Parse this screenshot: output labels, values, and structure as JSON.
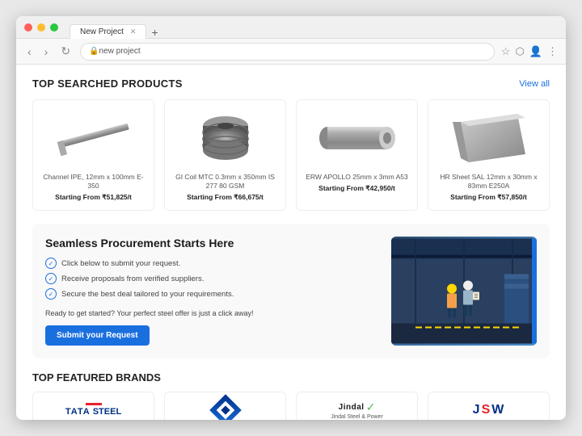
{
  "browser": {
    "tab_title": "New Project",
    "address": "new project",
    "new_tab_symbol": "+",
    "nav_back": "‹",
    "nav_forward": "›"
  },
  "sections": {
    "top_products": {
      "title": "TOP SEARCHED PRODUCTS",
      "view_all": "View all",
      "products": [
        {
          "name": "Channel IPE, 12mm x 100mm E-350",
          "price": "Starting From ₹51,825/t",
          "type": "channel"
        },
        {
          "name": "GI Coil MTC 0.3mm x 350mm IS 277 80 GSM",
          "price": "Starting From ₹66,675/t",
          "type": "coil"
        },
        {
          "name": "ERW APOLLO 25mm x 3mm A53",
          "price": "Starting From ₹42,950/t",
          "type": "pipe"
        },
        {
          "name": "HR Sheet SAL 12mm x 30mm x 83mm E250A",
          "price": "Starting From ₹57,850/t",
          "type": "sheet"
        }
      ]
    },
    "procurement": {
      "title": "Seamless Procurement Starts Here",
      "checklist": [
        "Click below to submit your request.",
        "Receive proposals from verified suppliers.",
        "Secure the best deal tailored to your requirements."
      ],
      "cta_text": "Ready to get started? Your perfect steel offer is just a click away!",
      "button_label": "Submit your Request"
    },
    "brands": {
      "title": "TOP FEATURED BRANDS",
      "items": [
        {
          "name": "TATA STEEL",
          "type": "tata"
        },
        {
          "name": "Diamond",
          "type": "diamond"
        },
        {
          "name": "Jindal Steel & Power",
          "type": "jindal"
        },
        {
          "name": "JSW",
          "type": "jsw"
        }
      ]
    }
  }
}
